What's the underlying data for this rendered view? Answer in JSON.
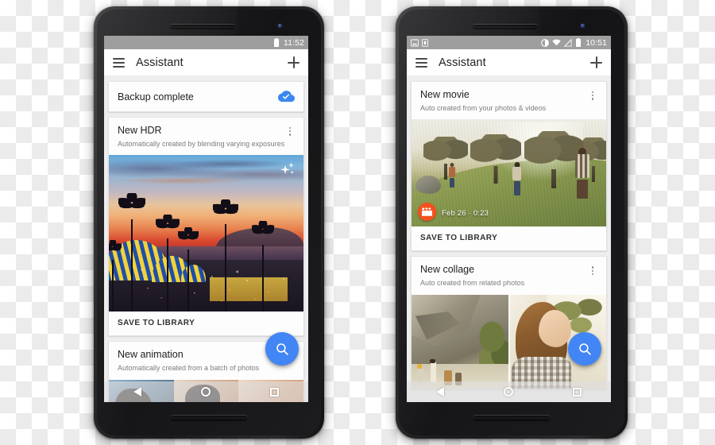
{
  "scene": {
    "description": "Two Android smartphones showing the Google Photos Assistant screen",
    "background": "transparent-checkerboard"
  },
  "phone_left": {
    "status_bar": {
      "battery_icon": "battery-icon",
      "clock": "11:52"
    },
    "app_bar": {
      "menu_icon": "hamburger-menu-icon",
      "title": "Assistant",
      "add_icon": "plus-icon"
    },
    "cards": [
      {
        "type": "backup",
        "title": "Backup complete",
        "status_icon": "cloud-done-icon"
      },
      {
        "type": "hdr",
        "title": "New HDR",
        "subtitle": "Automatically created by blending varying exposures",
        "overflow_icon": "more-vert-icon",
        "photo_alt": "Sunset over beach city with palm tree silhouettes and blue-yellow circus tent",
        "badge_icon": "sparkle-icon",
        "action": "SAVE TO LIBRARY"
      },
      {
        "type": "animation",
        "title": "New animation",
        "subtitle": "Automatically created from a batch of photos",
        "photo_alt": "Animation frames of people"
      }
    ],
    "fab": {
      "icon": "search-icon",
      "color": "#4285f4"
    },
    "nav_bar": {
      "back": "back-triangle-icon",
      "home": "home-circle-icon",
      "recents": "recents-square-icon"
    }
  },
  "phone_right": {
    "status_bar": {
      "left_icons": [
        "photo-icon",
        "sim-card-icon"
      ],
      "right_icons": [
        "do-not-disturb-icon",
        "wifi-icon",
        "signal-off-icon",
        "battery-icon"
      ],
      "clock": "10:51"
    },
    "app_bar": {
      "menu_icon": "hamburger-menu-icon",
      "title": "Assistant",
      "add_icon": "plus-icon"
    },
    "cards": [
      {
        "type": "movie",
        "title": "New movie",
        "subtitle": "Auto created from your photos & videos",
        "overflow_icon": "more-vert-icon",
        "photo_alt": "Three hikers walking up a grassy oak-covered hillside",
        "badge_icon": "movie-clapper-icon",
        "meta": "Feb 26 · 0:23",
        "action": "SAVE TO LIBRARY"
      },
      {
        "type": "collage",
        "title": "New collage",
        "subtitle": "Auto created from related photos",
        "overflow_icon": "more-vert-icon",
        "photo_left_alt": "Rock climbers at the base of a large boulder",
        "photo_right_alt": "Smiling woman in plaid shirt outdoors under tree branches"
      }
    ],
    "fab": {
      "icon": "search-icon",
      "color": "#4285f4"
    },
    "nav_bar": {
      "back": "back-triangle-icon",
      "home": "home-circle-icon",
      "recents": "recents-square-icon"
    }
  }
}
